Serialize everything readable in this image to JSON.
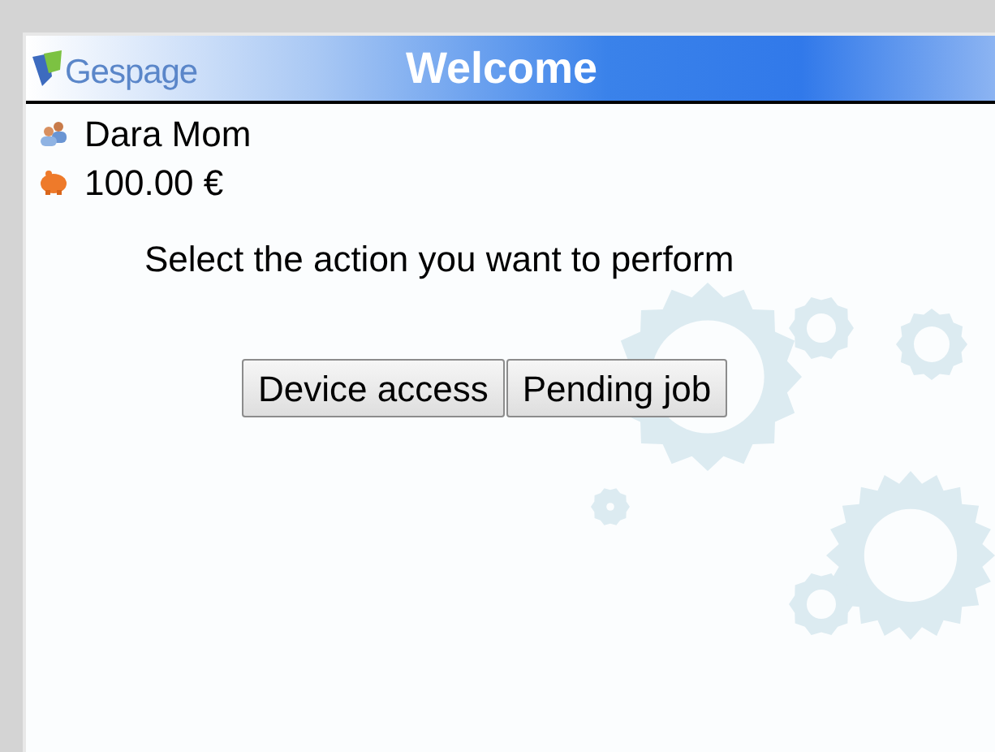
{
  "header": {
    "logo": "Gespage",
    "title": "Welcome"
  },
  "user": {
    "name": "Dara Mom",
    "balance": "100.00 €"
  },
  "prompt": "Select the action you want to perform",
  "buttons": [
    "Device access",
    "Pending job"
  ]
}
